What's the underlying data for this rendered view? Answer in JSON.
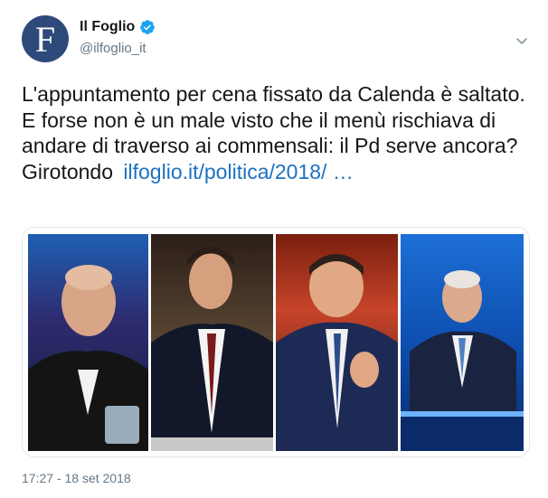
{
  "account": {
    "avatar_letter": "F",
    "display_name": "Il Foglio",
    "handle": "@ilfoglio_it",
    "verified": true,
    "brand_color": "#2d4a7a"
  },
  "tweet": {
    "text": "L'appuntamento per cena fissato da Calenda è saltato. E forse non è un male visto che il menù rischiava di andare di traverso ai commensali: il Pd serve ancora? Girotondo",
    "link": "ilfoglio.it/politica/2018/  …",
    "link_color": "#1b72c2"
  },
  "media": {
    "photos": [
      "photo-1",
      "photo-2",
      "photo-3",
      "photo-4"
    ]
  },
  "timestamp": "17:27 - 18 set 2018",
  "icons": {
    "verified": "verified-badge-icon",
    "caret": "chevron-down-icon"
  }
}
